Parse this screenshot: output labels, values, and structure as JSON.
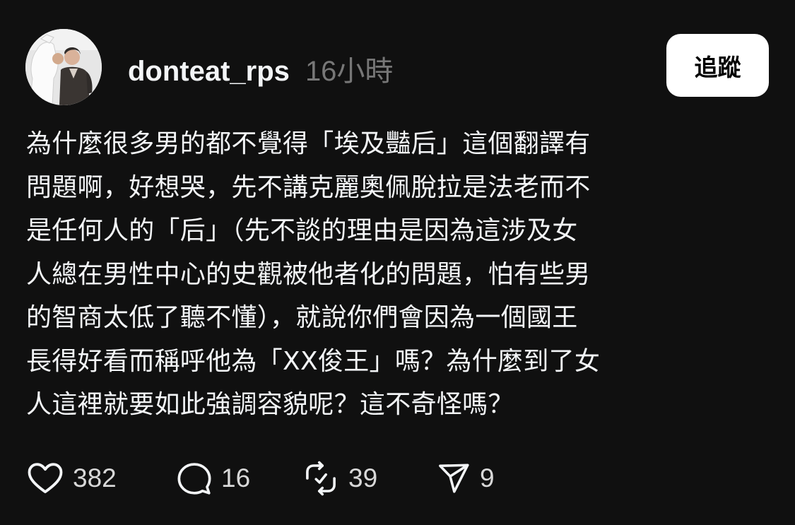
{
  "post": {
    "author": {
      "username": "donteat_rps",
      "avatar_icon": "profile-photo-avatar"
    },
    "timestamp": "16小時",
    "follow_label": "追蹤",
    "text": "為什麼很多男的都不覺得「埃及豔后」這個翻譯有\n問題啊，好想哭，先不講克麗奧佩脫拉是法老而不\n是任何人的「后」（先不談的理由是因為這涉及女\n人總在男性中心的史觀被他者化的問題，怕有些男\n的智商太低了聽不懂），就說你們會因為一個國王\n長得好看而稱呼他為「XX俊王」嗎？為什麼到了女\n人這裡就要如此強調容貌呢？這不奇怪嗎？",
    "stats": {
      "likes": "382",
      "replies": "16",
      "reposts": "39",
      "shares": "9"
    }
  },
  "icons": {
    "like": "heart-icon",
    "reply": "comment-bubble-icon",
    "repost": "repost-icon",
    "share": "send-icon"
  },
  "colors": {
    "background": "#101010",
    "text_primary": "#f3f5f7",
    "text_secondary": "#777777",
    "button_bg": "#ffffff",
    "button_text": "#000000"
  }
}
